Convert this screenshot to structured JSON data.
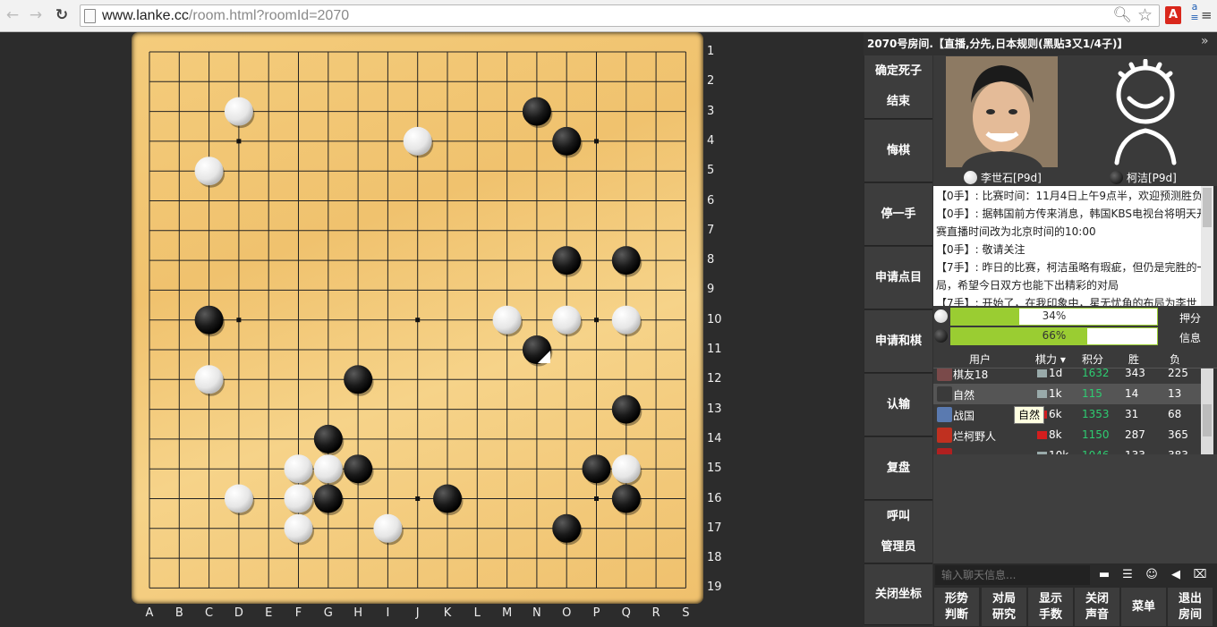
{
  "browser": {
    "url_host": "www.lanke.cc",
    "url_path": "/room.html?roomId=2070",
    "back_icon": "←",
    "forward_icon": "→",
    "reload_icon": "↻"
  },
  "room": {
    "title": "2070号房间.【直播,分先,日本规则(黑贴3又1/4子)】",
    "collapse_icon": "»"
  },
  "board": {
    "size": 19,
    "columns": [
      "A",
      "B",
      "C",
      "D",
      "E",
      "F",
      "G",
      "H",
      "I",
      "J",
      "K",
      "L",
      "M",
      "N",
      "O",
      "P",
      "Q",
      "R",
      "S"
    ],
    "rows": [
      "1",
      "2",
      "3",
      "4",
      "5",
      "6",
      "7",
      "8",
      "9",
      "10",
      "11",
      "12",
      "13",
      "14",
      "15",
      "16",
      "17",
      "18",
      "19"
    ],
    "stones": [
      {
        "color": "white",
        "col": "D",
        "row": 3
      },
      {
        "color": "black",
        "col": "N",
        "row": 3
      },
      {
        "color": "white",
        "col": "J",
        "row": 4
      },
      {
        "color": "black",
        "col": "O",
        "row": 4
      },
      {
        "color": "white",
        "col": "C",
        "row": 5
      },
      {
        "color": "black",
        "col": "O",
        "row": 8
      },
      {
        "color": "black",
        "col": "Q",
        "row": 8
      },
      {
        "color": "black",
        "col": "C",
        "row": 10
      },
      {
        "color": "white",
        "col": "M",
        "row": 10
      },
      {
        "color": "white",
        "col": "O",
        "row": 10
      },
      {
        "color": "white",
        "col": "Q",
        "row": 10
      },
      {
        "color": "black",
        "col": "N",
        "row": 11,
        "last_move": true
      },
      {
        "color": "white",
        "col": "C",
        "row": 12
      },
      {
        "color": "black",
        "col": "H",
        "row": 12
      },
      {
        "color": "black",
        "col": "Q",
        "row": 13
      },
      {
        "color": "black",
        "col": "G",
        "row": 14
      },
      {
        "color": "white",
        "col": "F",
        "row": 15
      },
      {
        "color": "white",
        "col": "G",
        "row": 15
      },
      {
        "color": "black",
        "col": "H",
        "row": 15
      },
      {
        "color": "black",
        "col": "P",
        "row": 15
      },
      {
        "color": "white",
        "col": "Q",
        "row": 15
      },
      {
        "color": "white",
        "col": "D",
        "row": 16
      },
      {
        "color": "white",
        "col": "F",
        "row": 16
      },
      {
        "color": "black",
        "col": "G",
        "row": 16
      },
      {
        "color": "black",
        "col": "K",
        "row": 16
      },
      {
        "color": "black",
        "col": "Q",
        "row": 16
      },
      {
        "color": "white",
        "col": "F",
        "row": 17
      },
      {
        "color": "white",
        "col": "I",
        "row": 17
      },
      {
        "color": "black",
        "col": "O",
        "row": 17
      }
    ]
  },
  "side_buttons": [
    "确定死子",
    "结束",
    "悔棋",
    "停一手",
    "申请点目",
    "申请和棋",
    "认输",
    "复盘",
    "呼叫",
    "管理员",
    "关闭坐标"
  ],
  "players": {
    "white": {
      "name": "李世石[P9d]",
      "stone": "white",
      "photo": "player-photo"
    },
    "black": {
      "name": "柯洁[P9d]",
      "stone": "black",
      "avatar": "default-avatar-icon"
    }
  },
  "chat_messages": [
    "【0手】: 比赛时间：11月4日上午9点半，欢迎预测胜负",
    "【0手】: 据韩国前方传来消息，韩国KBS电视台将明天开赛直播时间改为北京时间的10:00",
    "【0手】: 敬请关注",
    "【7手】: 昨日的比赛，柯洁虽略有瑕疵，但仍是完胜的一局，希望今日双方也能下出精彩的对局",
    "【7手】: 开始了，在我印象中，星无忧角的布局为李世"
  ],
  "prediction": {
    "white_pct": 34,
    "white_label": "34%",
    "black_pct": 66,
    "black_label": "66%",
    "bet_label": "押分",
    "info_label": "信息"
  },
  "user_table": {
    "headers": [
      "用户",
      "棋力",
      "积分",
      "胜",
      "负"
    ],
    "rows": [
      {
        "name": "棋友18",
        "rank": "1d",
        "score": "1632",
        "win": "343",
        "lose": "225"
      },
      {
        "name": "自然",
        "rank": "1k",
        "score": "115",
        "win": "14",
        "lose": "13"
      },
      {
        "name": "战国",
        "rank": "6k",
        "score": "1353",
        "win": "31",
        "lose": "68"
      },
      {
        "name": "烂柯野人",
        "rank": "8k",
        "score": "1150",
        "win": "287",
        "lose": "365"
      },
      {
        "name": "",
        "rank": "10k",
        "score": "1046",
        "win": "133",
        "lose": "383"
      }
    ],
    "tooltip": "自然"
  },
  "chat_input": {
    "placeholder": "输入聊天信息..."
  },
  "chat_icons": [
    "message-icon",
    "list-icon",
    "emoji-icon",
    "megaphone-icon",
    "trash-icon"
  ],
  "bottom_buttons": [
    {
      "l1": "形势",
      "l2": "判断"
    },
    {
      "l1": "对局",
      "l2": "研究"
    },
    {
      "l1": "显示",
      "l2": "手数"
    },
    {
      "l1": "关闭",
      "l2": "声音"
    },
    {
      "l1": "菜单",
      "l2": ""
    },
    {
      "l1": "退出",
      "l2": "房间"
    }
  ],
  "colors": {
    "board": "#f0c26e",
    "accent": "#9acd32",
    "panel": "#3a3a3a",
    "score_green": "#2ecc71"
  }
}
